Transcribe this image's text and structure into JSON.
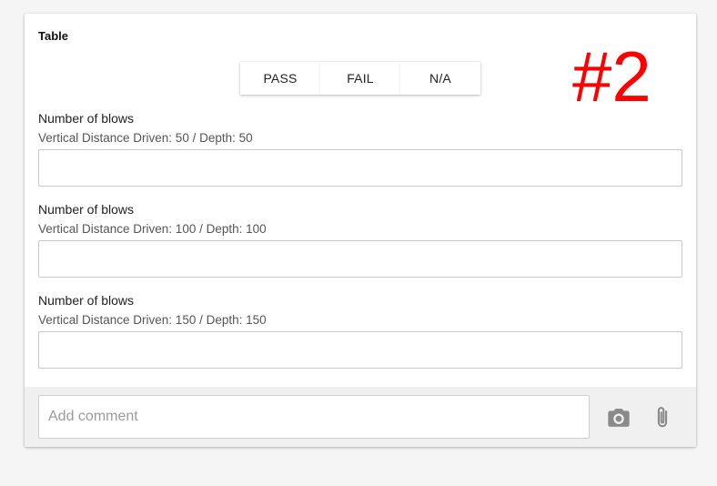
{
  "card": {
    "title": "Table"
  },
  "result_options": {
    "pass_label": "PASS",
    "fail_label": "FAIL",
    "na_label": "N/A"
  },
  "annotation": {
    "text": "#2",
    "color": "#ff0000"
  },
  "fields": [
    {
      "label": "Number of blows",
      "subtitle": "Vertical Distance Driven: 50 / Depth: 50",
      "value": ""
    },
    {
      "label": "Number of blows",
      "subtitle": "Vertical Distance Driven: 100 / Depth: 100",
      "value": ""
    },
    {
      "label": "Number of blows",
      "subtitle": "Vertical Distance Driven: 150 / Depth: 150",
      "value": ""
    }
  ],
  "footer": {
    "comment_placeholder": "Add comment",
    "comment_value": "",
    "camera_icon": "camera-icon",
    "attach_icon": "paperclip-icon"
  }
}
